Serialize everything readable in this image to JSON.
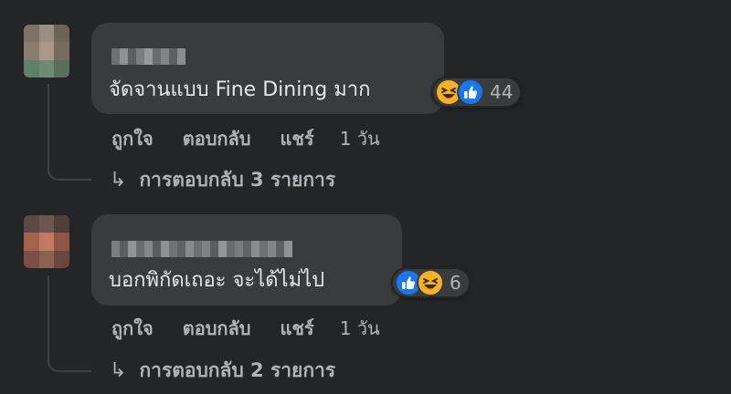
{
  "comments": [
    {
      "text": "จัดจานแบบ Fine Dining มาก",
      "reactions": [
        "haha",
        "like"
      ],
      "reaction_count": "44",
      "actions": {
        "like": "ถูกใจ",
        "reply": "ตอบกลับ",
        "share": "แชร์",
        "time": "1 วัน"
      },
      "replies_label": "การตอบกลับ 3 รายการ",
      "reply_arrow": "↳"
    },
    {
      "text": "บอกพิกัดเถอะ จะได้ไม่ไป",
      "reactions": [
        "like",
        "haha"
      ],
      "reaction_count": "6",
      "actions": {
        "like": "ถูกใจ",
        "reply": "ตอบกลับ",
        "share": "แชร์",
        "time": "1 วัน"
      },
      "replies_label": "การตอบกลับ 2 รายการ",
      "reply_arrow": "↳"
    }
  ],
  "colors": {
    "background": "#242526",
    "bubble": "#3a3b3c",
    "text": "#e4e6eb",
    "secondary_text": "#b0b3b8",
    "like_blue": "#1877f2",
    "haha_yellow": "#f7b125"
  }
}
